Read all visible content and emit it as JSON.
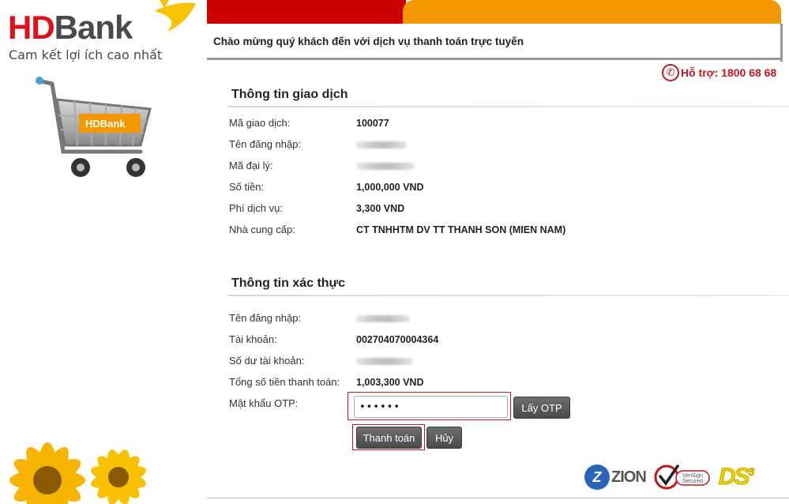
{
  "brand": {
    "logo_hd": "HD",
    "logo_bank": "Bank",
    "slogan": "Cam kết lợi ích cao nhất",
    "cart_label": "HDBank",
    "colors": {
      "red": "#cc0000",
      "orange": "#f39800",
      "support_red": "#c4161c"
    }
  },
  "header": {
    "welcome": "Chào mừng quý khách đến với dịch vụ thanh toán trực tuyến",
    "support": "Hỗ trợ: 1800 68 68",
    "support_icon": "phone-icon"
  },
  "transaction": {
    "title": "Thông tin giao dịch",
    "rows": [
      {
        "label": "Mã giao dịch:",
        "value": "100077"
      },
      {
        "label": "Tên đăng nhập:",
        "value": ""
      },
      {
        "label": "Mã đại lý:",
        "value": ""
      },
      {
        "label": "Số tiền:",
        "value": "1,000,000 VND"
      },
      {
        "label": "Phí dịch vụ:",
        "value": "3,300 VND"
      },
      {
        "label": "Nhà cung cấp:",
        "value": "CT TNHHTM DV TT THANH SON (MIEN NAM)"
      }
    ]
  },
  "auth": {
    "title": "Thông tin xác thực",
    "rows": [
      {
        "label": "Tên đăng nhập:",
        "value": ""
      },
      {
        "label": "Tài khoản:",
        "value": "002704070004364"
      },
      {
        "label": "Số dư tài khoản:",
        "value": ""
      },
      {
        "label": "Tổng số tiền thanh toán:",
        "value": "1,003,300 VND"
      }
    ],
    "otp_label": "Mật khẩu OTP:",
    "otp_value": "••••••",
    "get_otp_button": "Lấy OTP",
    "pay_button": "Thanh toán",
    "cancel_button": "Hủy"
  },
  "footer": {
    "zion": "ZION",
    "verisign_line1": "VeriSign",
    "verisign_line2": "Secured",
    "ds3": "DS",
    "ds3_sup": "3"
  }
}
